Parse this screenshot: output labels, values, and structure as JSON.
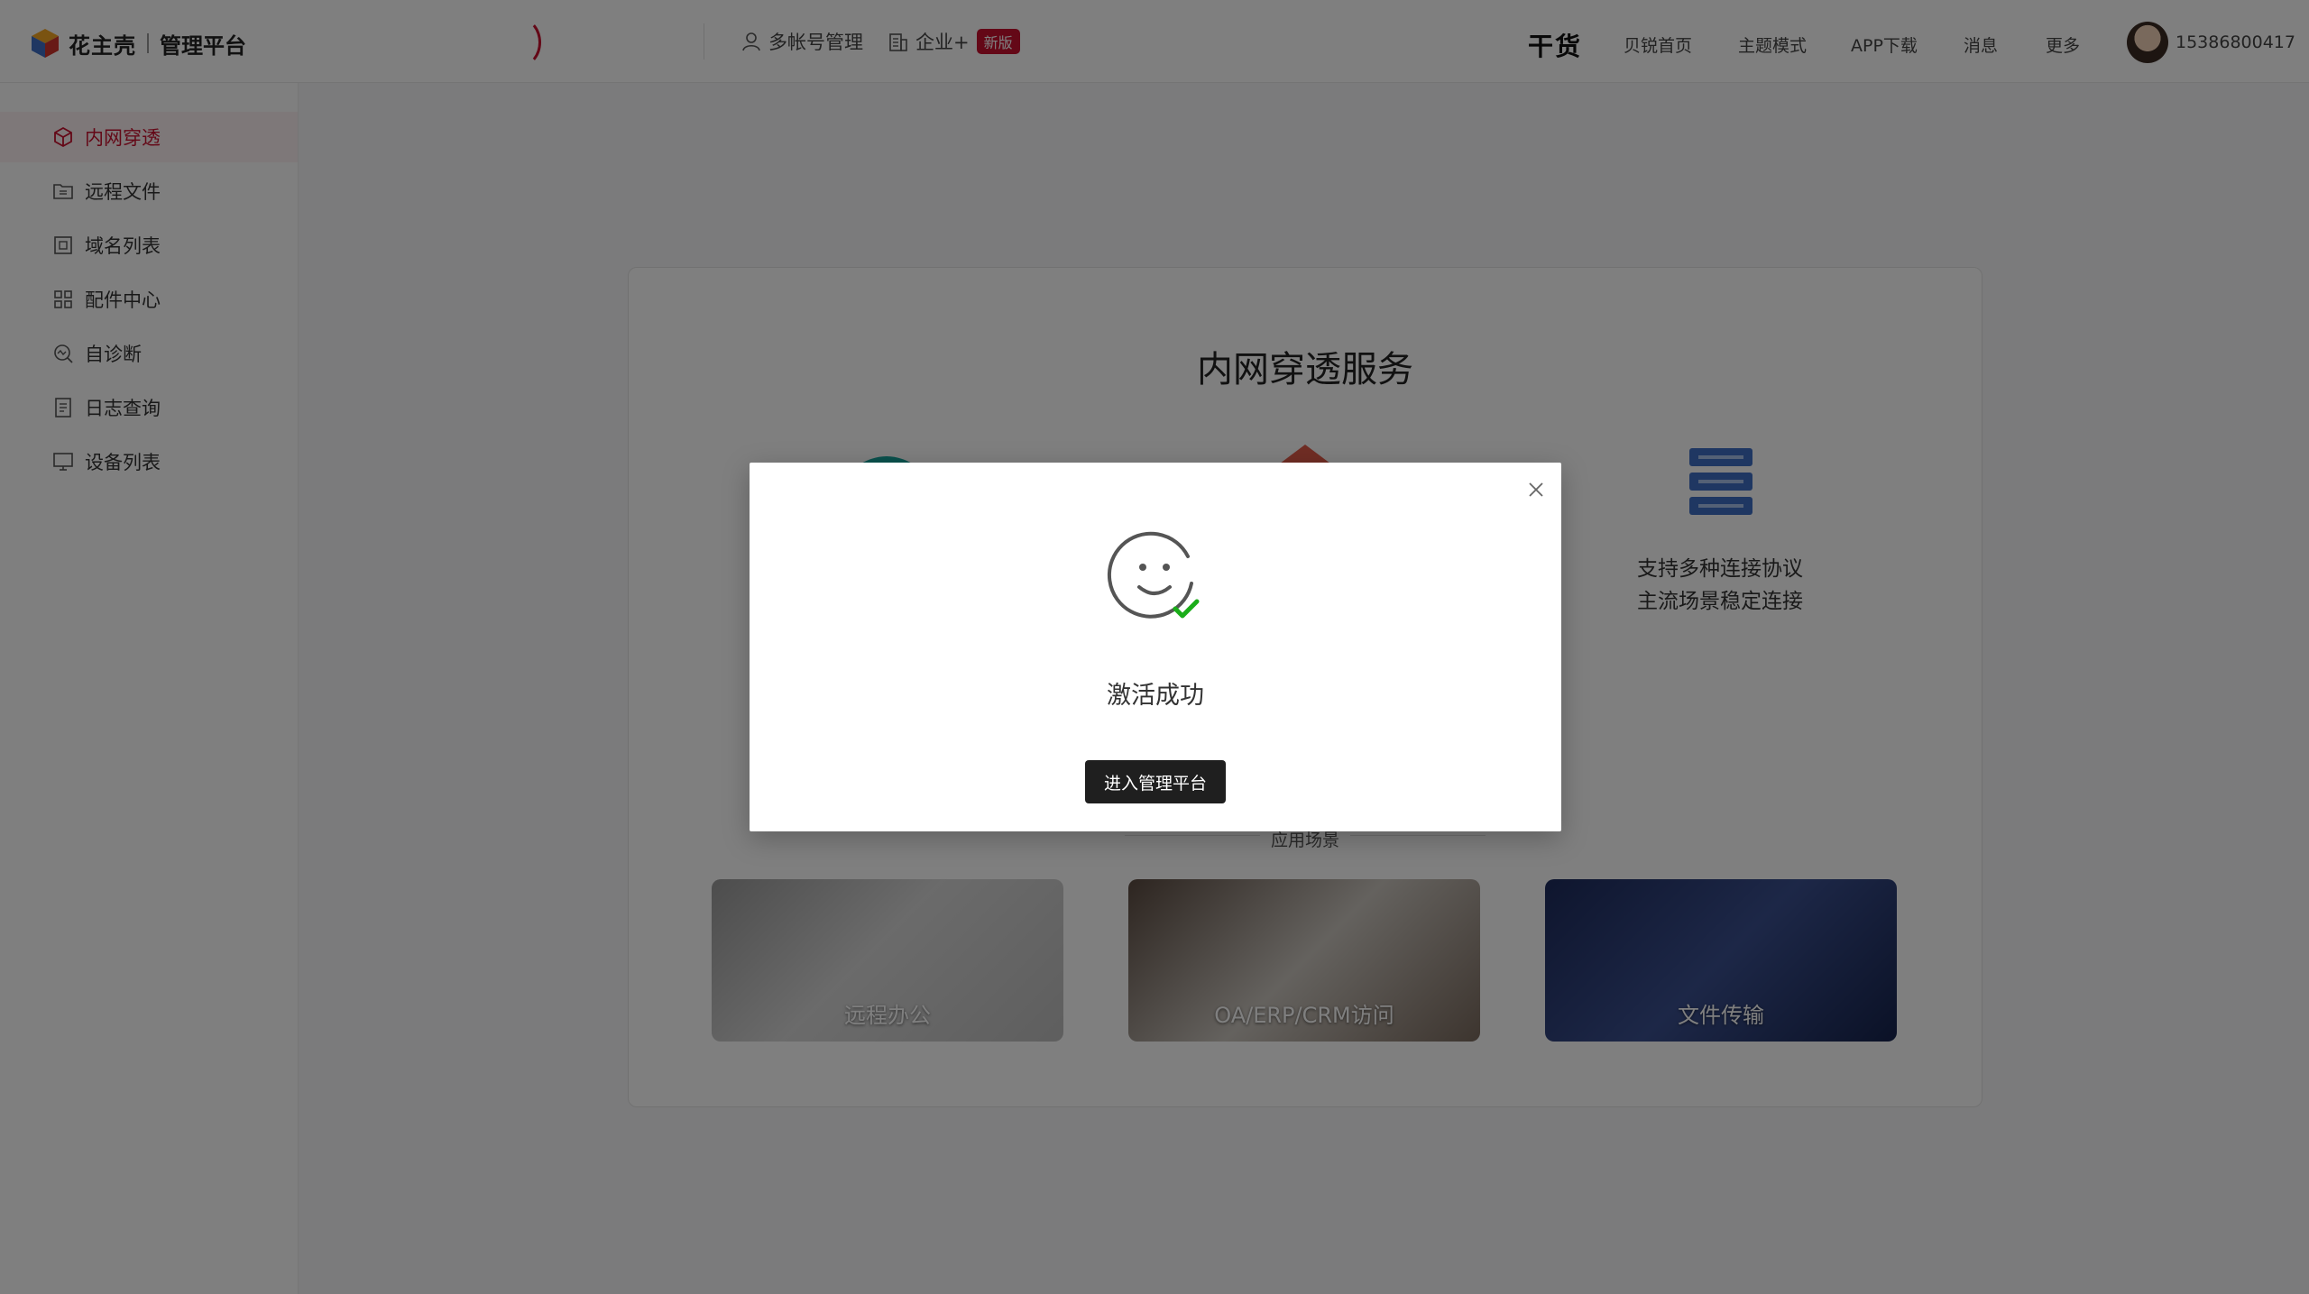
{
  "header": {
    "logo_name": "花主壳",
    "logo_sub": "管理平台",
    "links": [
      "多帐号管理",
      "企业+"
    ],
    "new_badge": "新版",
    "ganhuo": "干货",
    "nav": [
      "贝锐首页",
      "主题模式",
      "APP下载",
      "消息",
      "更多"
    ],
    "phone": "15386800417"
  },
  "sidebar": {
    "items": [
      {
        "label": "内网穿透",
        "icon": "cube-icon",
        "active": true
      },
      {
        "label": "远程文件",
        "icon": "folder-swap-icon"
      },
      {
        "label": "域名列表",
        "icon": "domain-list-icon"
      },
      {
        "label": "配件中心",
        "icon": "grid-apps-icon"
      },
      {
        "label": "自诊断",
        "icon": "diagnose-icon"
      },
      {
        "label": "日志查询",
        "icon": "log-document-icon"
      },
      {
        "label": "设备列表",
        "icon": "monitor-icon"
      }
    ]
  },
  "main": {
    "title": "内网穿透服务",
    "features": [
      {
        "icon": "teal-shield-icon",
        "line1": "",
        "line2": ""
      },
      {
        "icon": "red-diamond-icon",
        "line1": "",
        "line2": ""
      },
      {
        "icon": "server-stack-icon",
        "line1": "支持多种连接协议",
        "line2": "主流场景稳定连接"
      }
    ],
    "scenes_label": "应用场景",
    "scenes": [
      {
        "label": "远程办公"
      },
      {
        "label": "OA/ERP/CRM访问"
      },
      {
        "label": "文件传输"
      }
    ]
  },
  "modal": {
    "message": "激活成功",
    "button": "进入管理平台"
  },
  "colors": {
    "accent": "#c8102e",
    "success": "#1aad19",
    "server_blue": "#3f6fc4"
  }
}
